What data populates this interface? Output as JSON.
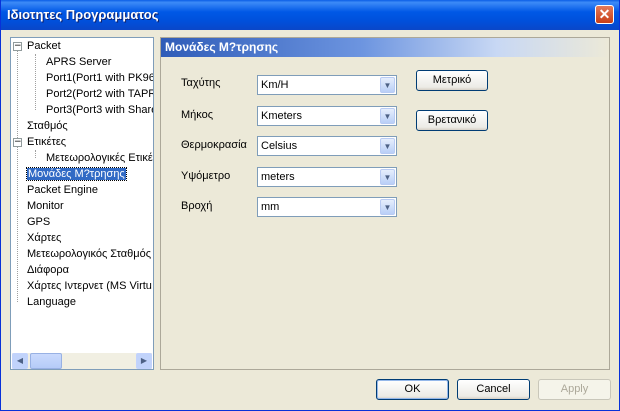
{
  "window": {
    "title": "Ιδιοτητες Προγραμματος",
    "close_glyph": "✕"
  },
  "tree": {
    "items": [
      {
        "label": "Packet",
        "expander": "−"
      },
      {
        "label": "APRS Server"
      },
      {
        "label": "Port1(Port1 with PK96"
      },
      {
        "label": "Port2(Port2 with TAPR"
      },
      {
        "label": "Port3(Port3 with Share"
      },
      {
        "label": "Σταθμός"
      },
      {
        "label": "Ετικέτες",
        "expander": "−"
      },
      {
        "label": "Μετεωρολογικές Ετικέ"
      },
      {
        "label": "Μονάδες Μ?τρησης",
        "selected": true
      },
      {
        "label": "Packet Engine"
      },
      {
        "label": "Monitor"
      },
      {
        "label": "GPS"
      },
      {
        "label": "Χάρτες"
      },
      {
        "label": "Μετεωρολογικός Σταθμός"
      },
      {
        "label": "Διάφορα"
      },
      {
        "label": "Χάρτες Ιντερνετ (MS Virtu"
      },
      {
        "label": "Language"
      }
    ],
    "scroll_left": "◀",
    "scroll_right": "▶"
  },
  "panel": {
    "title": "Μονάδες Μ?τρησης",
    "fields": [
      {
        "label": "Ταχύτης",
        "value": "Km/H"
      },
      {
        "label": "Μήκος",
        "value": "Kmeters"
      },
      {
        "label": "Θερμοκρασία",
        "value": "Celsius"
      },
      {
        "label": "Υψόμετρο",
        "value": "meters"
      },
      {
        "label": "Βροχή",
        "value": "mm"
      }
    ],
    "combo_arrow": "▼",
    "metric_button": "Μετρικό",
    "british_button": "Βρετανικό"
  },
  "footer": {
    "ok": "OK",
    "cancel": "Cancel",
    "apply": "Apply"
  }
}
